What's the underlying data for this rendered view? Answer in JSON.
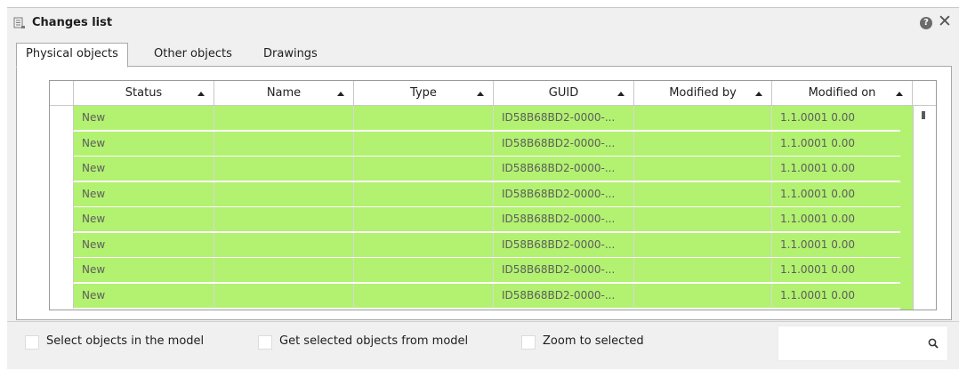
{
  "window": {
    "title": "Changes list"
  },
  "tabs": [
    {
      "label": "Physical objects",
      "active": true
    },
    {
      "label": "Other objects",
      "active": false
    },
    {
      "label": "Drawings",
      "active": false
    }
  ],
  "table": {
    "columns": [
      "Status",
      "Name",
      "Type",
      "GUID",
      "Modified by",
      "Modified on"
    ],
    "rows": [
      {
        "status": "New",
        "name": "",
        "type": "",
        "guid": "ID58B68BD2-0000-...",
        "modified_by": "",
        "modified_on": "1.1.0001 0.00"
      },
      {
        "status": "New",
        "name": "",
        "type": "",
        "guid": "ID58B68BD2-0000-...",
        "modified_by": "",
        "modified_on": "1.1.0001 0.00"
      },
      {
        "status": "New",
        "name": "",
        "type": "",
        "guid": "ID58B68BD2-0000-...",
        "modified_by": "",
        "modified_on": "1.1.0001 0.00"
      },
      {
        "status": "New",
        "name": "",
        "type": "",
        "guid": "ID58B68BD2-0000-...",
        "modified_by": "",
        "modified_on": "1.1.0001 0.00"
      },
      {
        "status": "New",
        "name": "",
        "type": "",
        "guid": "ID58B68BD2-0000-...",
        "modified_by": "",
        "modified_on": "1.1.0001 0.00"
      },
      {
        "status": "New",
        "name": "",
        "type": "",
        "guid": "ID58B68BD2-0000-...",
        "modified_by": "",
        "modified_on": "1.1.0001 0.00"
      },
      {
        "status": "New",
        "name": "",
        "type": "",
        "guid": "ID58B68BD2-0000-...",
        "modified_by": "",
        "modified_on": "1.1.0001 0.00"
      },
      {
        "status": "New",
        "name": "",
        "type": "",
        "guid": "ID58B68BD2-0000-...",
        "modified_by": "",
        "modified_on": "1.1.0001 0.00"
      }
    ],
    "row_color": "#b3f171"
  },
  "footer": {
    "select_in_model": "Select objects in the model",
    "get_selected": "Get selected objects from model",
    "zoom_to_selected": "Zoom to selected",
    "search_value": ""
  },
  "icons": {
    "title": "list-icon",
    "help": "help-icon",
    "close": "close-icon",
    "sort": "sort-ascending-icon",
    "search": "search-icon"
  }
}
